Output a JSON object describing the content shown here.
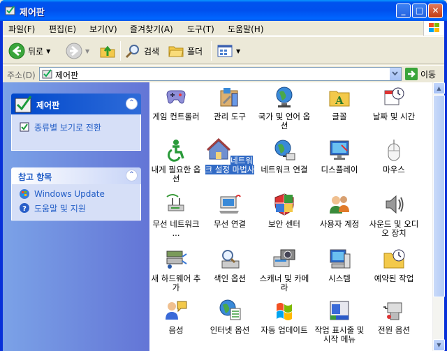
{
  "window": {
    "title": "제어판"
  },
  "menu": [
    "파일(F)",
    "편집(E)",
    "보기(V)",
    "즐겨찾기(A)",
    "도구(T)",
    "도움말(H)"
  ],
  "toolbar": {
    "back": "뒤로",
    "search": "검색",
    "folders": "폴더"
  },
  "address": {
    "label": "주소(D)",
    "value": "제어판",
    "go": "이동"
  },
  "left_pane": {
    "main_panel": {
      "title": "제어판",
      "task": "종류별 보기로 전환"
    },
    "see_also": {
      "title": "참고 항목",
      "links": [
        "Windows Update",
        "도움말 및 지원"
      ]
    }
  },
  "icons": [
    {
      "label": "게임 컨트롤러",
      "icon": "gamepad-icon"
    },
    {
      "label": "관리 도구",
      "icon": "admin-tools-icon"
    },
    {
      "label": "국가 및 언어 옵션",
      "icon": "globe-icon"
    },
    {
      "label": "글꼴",
      "icon": "fonts-folder-icon"
    },
    {
      "label": "날짜 및 시간",
      "icon": "calendar-clock-icon"
    },
    {
      "label": "내게 필요한 옵션",
      "icon": "accessibility-icon"
    },
    {
      "label": "네트워크 설정 마법사",
      "icon": "network-house-icon",
      "selected": true
    },
    {
      "label": "네트워크 연결",
      "icon": "network-globe-icon"
    },
    {
      "label": "디스플레이",
      "icon": "display-icon"
    },
    {
      "label": "마우스",
      "icon": "mouse-icon"
    },
    {
      "label": "무선 네트워크 ...",
      "icon": "wireless-network-icon"
    },
    {
      "label": "무선 연결",
      "icon": "wireless-link-icon"
    },
    {
      "label": "보안 센터",
      "icon": "security-shield-icon"
    },
    {
      "label": "사용자 계정",
      "icon": "user-accounts-icon"
    },
    {
      "label": "사운드 및 오디오 장치",
      "icon": "speaker-icon"
    },
    {
      "label": "새 하드웨어 추가",
      "icon": "add-hardware-icon"
    },
    {
      "label": "색인 옵션",
      "icon": "indexing-icon"
    },
    {
      "label": "스캐너 및 카메라",
      "icon": "scanner-camera-icon"
    },
    {
      "label": "시스템",
      "icon": "system-icon"
    },
    {
      "label": "예약된 작업",
      "icon": "scheduled-tasks-icon"
    },
    {
      "label": "음성",
      "icon": "speech-icon"
    },
    {
      "label": "인터넷 옵션",
      "icon": "internet-options-icon"
    },
    {
      "label": "자동 업데이트",
      "icon": "windows-flag-icon"
    },
    {
      "label": "작업 표시줄 및 시작 메뉴",
      "icon": "taskbar-icon"
    },
    {
      "label": "전원 옵션",
      "icon": "power-icon"
    }
  ]
}
